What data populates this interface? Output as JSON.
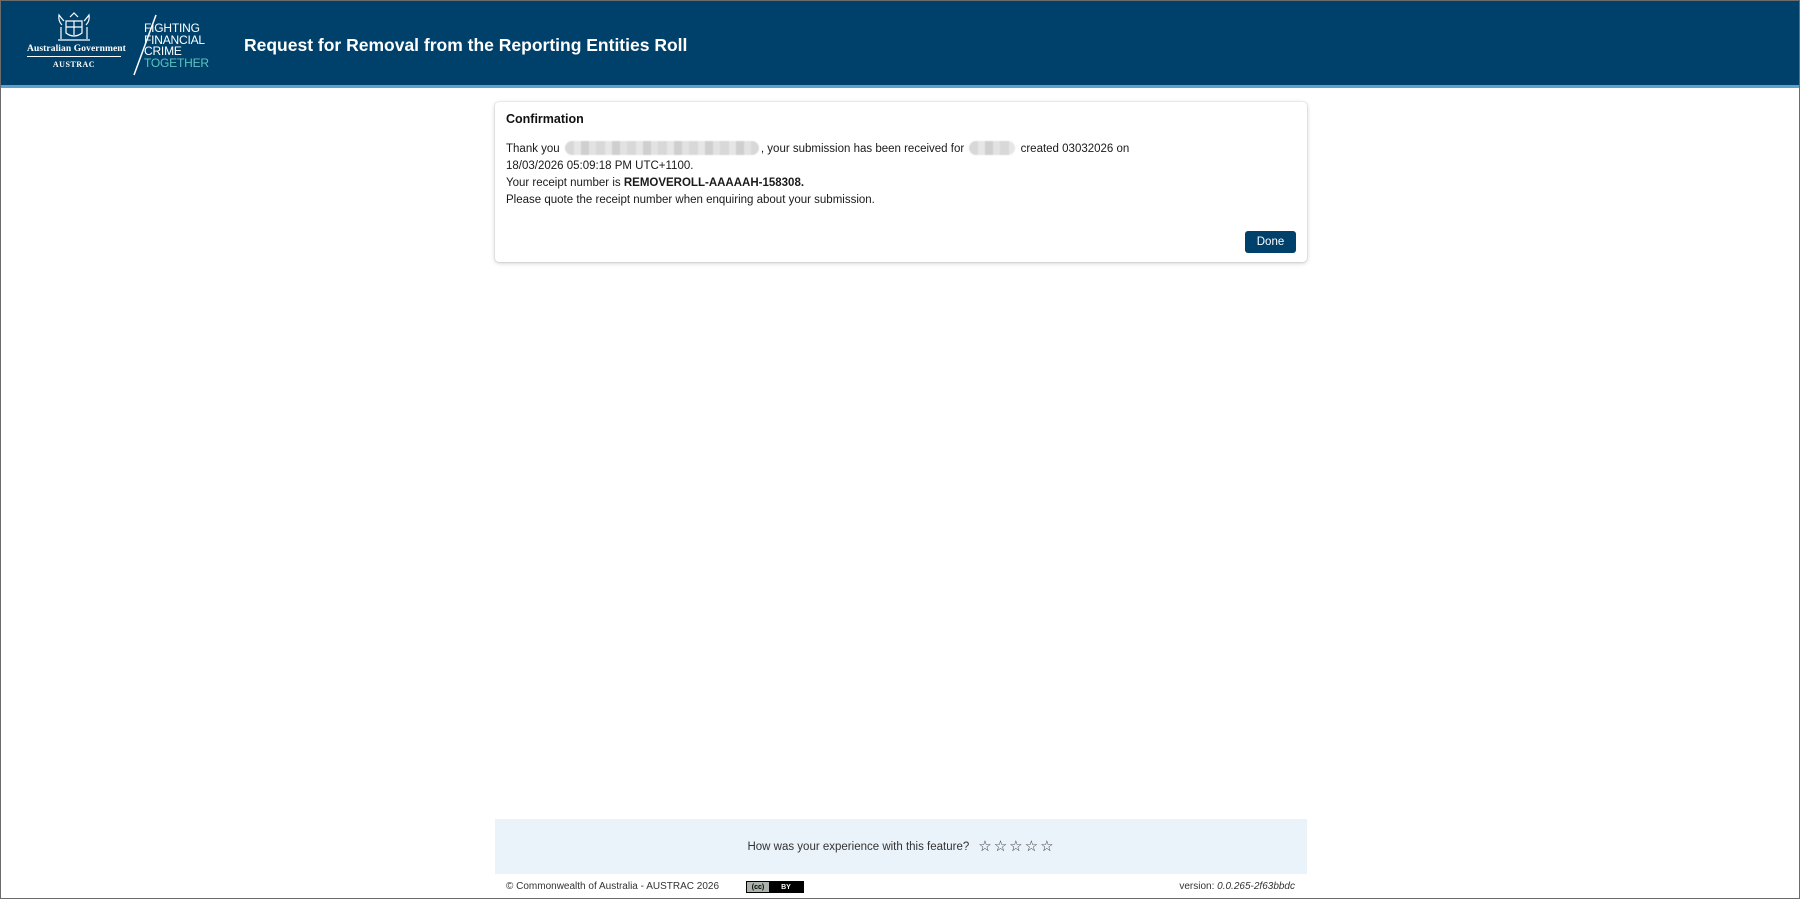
{
  "header": {
    "gov_name": "Australian Government",
    "agency": "AUSTRAC",
    "tagline": [
      "FIGHTING",
      "FINANCIAL",
      "CRIME",
      "TOGETHER"
    ],
    "page_title": "Request for Removal from the Reporting Entities Roll"
  },
  "confirmation": {
    "title": "Confirmation",
    "thank_you": "Thank you",
    "received_text": ", your submission has been received for",
    "created_text": "created 03032026 on",
    "timestamp": "18/03/2026 05:09:18 PM UTC+1100.",
    "receipt_prefix": "Your receipt number is",
    "receipt_number": "REMOVEROLL-AAAAAH-158308.",
    "quote_note": "Please quote the receipt number when enquiring about your submission.",
    "done_label": "Done"
  },
  "feedback": {
    "question": "How was your experience with this feature?",
    "star_glyph": "☆",
    "rating": 0,
    "max_rating": 5
  },
  "footer": {
    "copyright": "© Commonwealth of Australia - AUSTRAC 2026",
    "license_badge_left": "(cc)",
    "license_badge_right": "BY",
    "version_label": "version:",
    "version_value": "0.0.265-2f63bbdc"
  },
  "colors": {
    "header_bg": "#00416b",
    "header_accent": "#5aa1cc",
    "tagline_teal": "#5bc4c0",
    "button_bg": "#00416b",
    "feedback_bg": "#ebf3fa"
  }
}
